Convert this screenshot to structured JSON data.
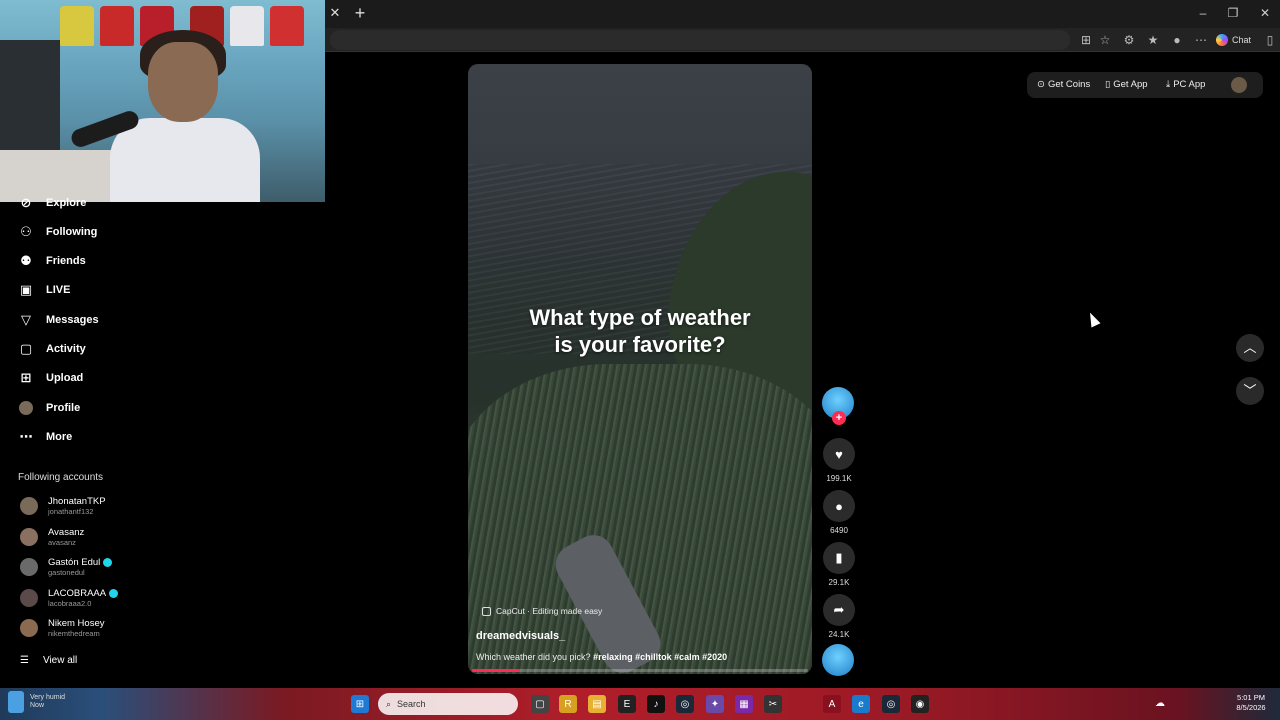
{
  "browser": {
    "chat_label": "Chat"
  },
  "sidebar": {
    "items": [
      {
        "label": "Explore",
        "icon": "compass-icon"
      },
      {
        "label": "Following",
        "icon": "person-add-icon"
      },
      {
        "label": "Friends",
        "icon": "people-icon"
      },
      {
        "label": "LIVE",
        "icon": "live-tv-icon"
      },
      {
        "label": "Messages",
        "icon": "send-icon"
      },
      {
        "label": "Activity",
        "icon": "activity-icon"
      },
      {
        "label": "Upload",
        "icon": "plus-square-icon"
      },
      {
        "label": "Profile",
        "icon": "avatar-icon"
      },
      {
        "label": "More",
        "icon": "ellipsis-icon"
      }
    ],
    "following_title": "Following accounts",
    "accounts": [
      {
        "name": "JhonatanTKP",
        "handle": "jonathantf132",
        "verified": false
      },
      {
        "name": "Avasanz",
        "handle": "avasanz",
        "verified": false
      },
      {
        "name": "Gastón Edul",
        "handle": "gastonedul",
        "verified": true
      },
      {
        "name": "LACOBRAAA",
        "handle": "lacobraaa2.0",
        "verified": true
      },
      {
        "name": "Nikem Hosey",
        "handle": "nikemthedream",
        "verified": false
      }
    ],
    "view_all": "View all"
  },
  "topbar": {
    "get_coins": "Get Coins",
    "get_app": "Get App",
    "pc_app": "PC App"
  },
  "video": {
    "overlay_line1": "What type of weather",
    "overlay_line2": "is your favorite?",
    "capcut": "CapCut · Editing made easy",
    "author": "dreamedvisuals_",
    "description": "Which weather did you pick?",
    "hashtags": "#relaxing #chilltok #calm #2020",
    "progress": 0.14
  },
  "actions": {
    "likes": "199.1K",
    "comments": "6490",
    "saves": "29.1K",
    "shares": "24.1K"
  },
  "taskbar": {
    "weather_line1": "Very humid",
    "weather_line2": "Now",
    "search_placeholder": "Search",
    "time": "5:01 PM",
    "date": "8/5/2026"
  },
  "colors": {
    "accent": "#fe2c55",
    "verified": "#20d5ec"
  }
}
